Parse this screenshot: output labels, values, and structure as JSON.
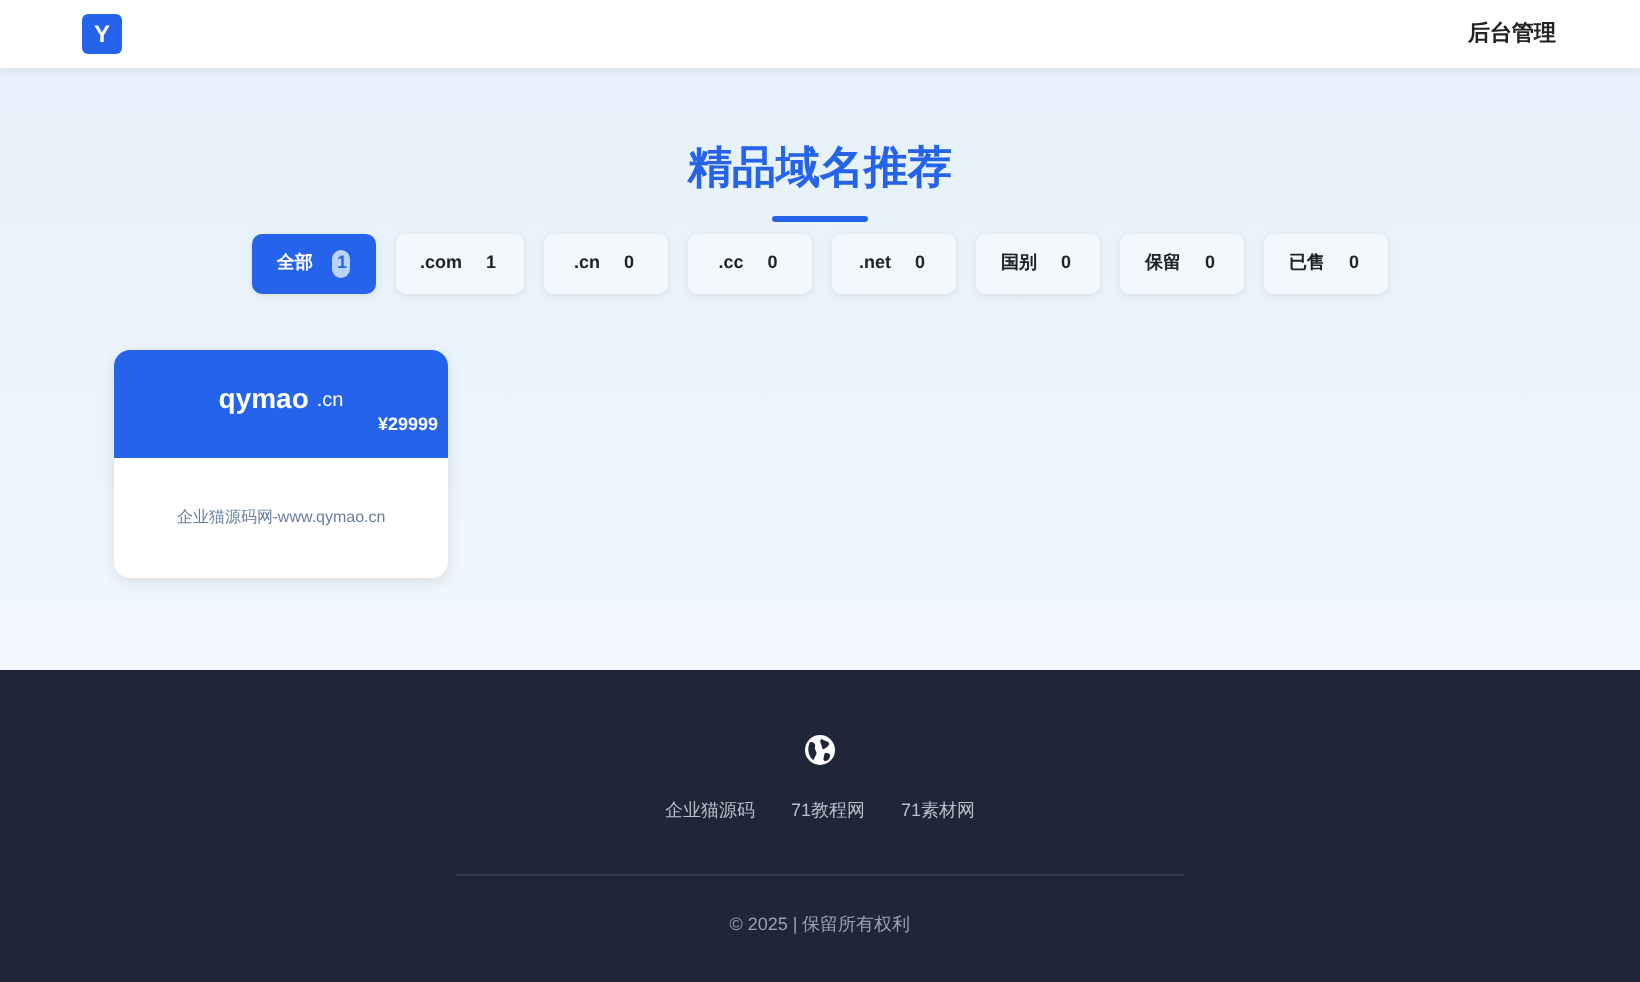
{
  "navbar": {
    "logo": "Y",
    "admin_link": "后台管理"
  },
  "title": "精品域名推荐",
  "filters": [
    {
      "label": "全部",
      "count": "1",
      "selected": true
    },
    {
      "label": ".com",
      "count": "1",
      "selected": false
    },
    {
      "label": ".cn",
      "count": "0",
      "selected": false
    },
    {
      "label": ".cc",
      "count": "0",
      "selected": false
    },
    {
      "label": ".net",
      "count": "0",
      "selected": false
    },
    {
      "label": "国别",
      "count": "0",
      "selected": false
    },
    {
      "label": "保留",
      "count": "0",
      "selected": false
    },
    {
      "label": "已售",
      "count": "0",
      "selected": false
    }
  ],
  "domains": [
    {
      "name": "qymao",
      "suffix": ".cn",
      "price": "¥29999",
      "description": "企业猫源码网-www.qymao.cn"
    }
  ],
  "footer": {
    "links": [
      "企业猫源码",
      "71教程网",
      "71素材网"
    ],
    "copyright": "© 2025 | 保留所有权利"
  }
}
